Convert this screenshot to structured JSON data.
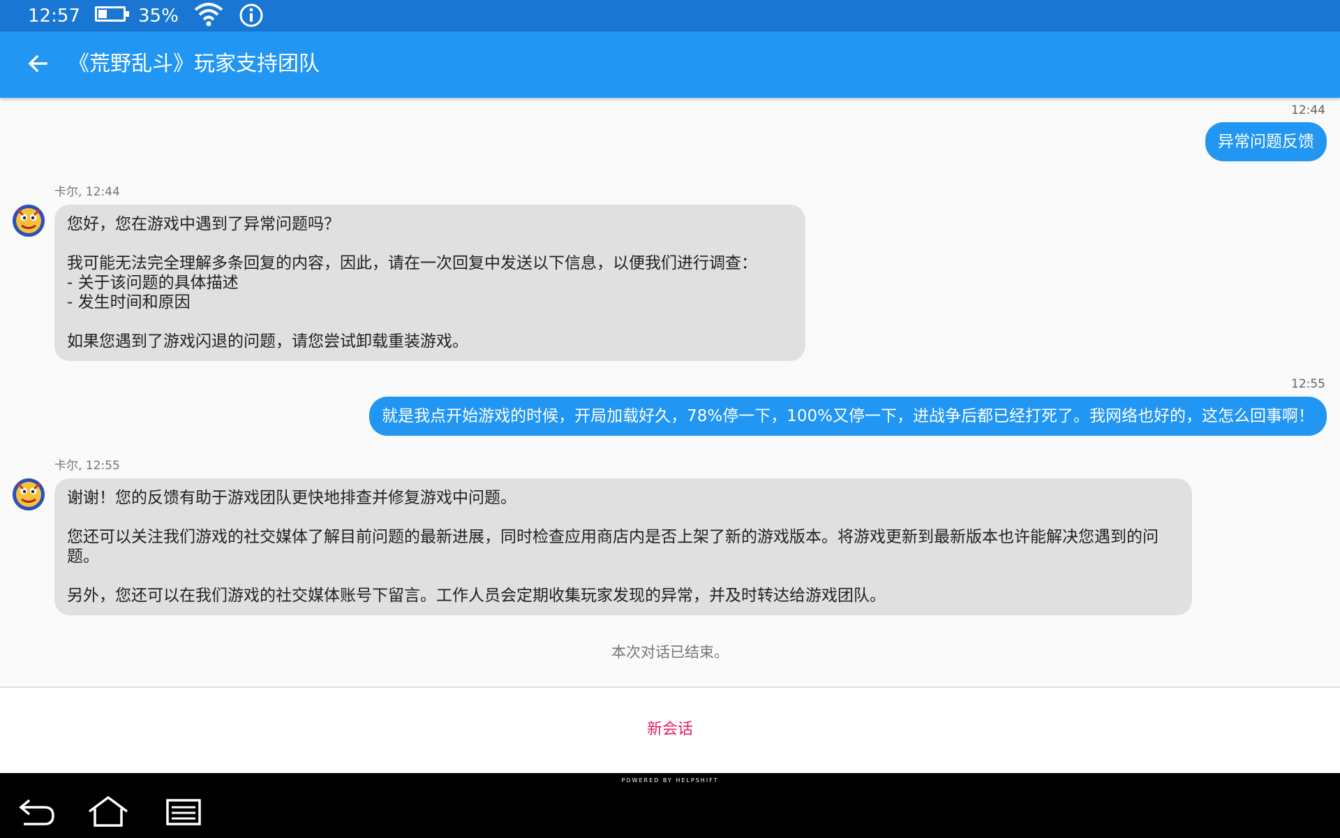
{
  "status_bar": {
    "time": "12:57",
    "battery_level": 0.35,
    "battery_text": "35%",
    "icons": [
      "battery-icon",
      "wifi-icon",
      "info-icon"
    ]
  },
  "app_bar": {
    "back_icon": "arrow-left-icon",
    "title": "《荒野乱斗》玩家支持团队",
    "color": "#2196f3"
  },
  "messages": [
    {
      "direction": "outgoing",
      "time": "12:44",
      "text": "异常问题反馈"
    },
    {
      "direction": "incoming",
      "sender": "卡尔, 12:44",
      "paragraphs": [
        "您好，您在游戏中遇到了异常问题吗？",
        "我可能无法完全理解多条回复的内容，因此，请在一次回复中发送以下信息，以便我们进行调查：\n- 关于该问题的具体描述\n- 发生时间和原因",
        "如果您遇到了游戏闪退的问题，请您尝试卸载重装游戏。"
      ]
    },
    {
      "direction": "outgoing",
      "time": "12:55",
      "text": "就是我点开始游戏的时候，开局加载好久，78%停一下，100%又停一下，进战争后都已经打死了。我网络也好的，这怎么回事啊！"
    },
    {
      "direction": "incoming",
      "sender": "卡尔, 12:55",
      "paragraphs": [
        "谢谢！您的反馈有助于游戏团队更快地排查并修复游戏中问题。",
        "您还可以关注我们游戏的社交媒体了解目前问题的最新进展，同时检查应用商店内是否上架了新的游戏版本。将游戏更新到最新版本也许能解决您遇到的问题。",
        "另外，您还可以在我们游戏的社交媒体账号下留言。工作人员会定期收集玩家发现的异常，并及时转达给游戏团队。"
      ]
    }
  ],
  "conversation_ended": "本次对话已结束。",
  "new_conversation_button": "新会话",
  "new_conversation_color": "#e91e63",
  "powered_by": "POWERED BY HELPSHIFT",
  "nav_bar": [
    "back-icon",
    "home-icon",
    "recents-icon"
  ]
}
